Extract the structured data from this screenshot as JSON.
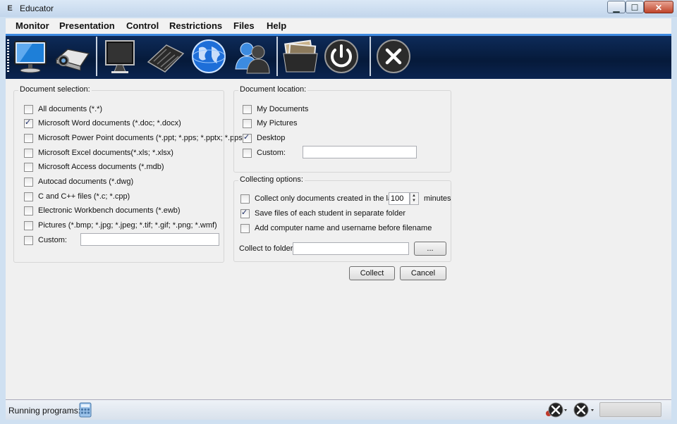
{
  "window": {
    "title": "Educator",
    "app_icon": "E"
  },
  "window_controls": {
    "minimize": "▁",
    "maximize": "☐",
    "close": "✕"
  },
  "menu": [
    "Monitor",
    "Presentation",
    "Control",
    "Restrictions",
    "Files",
    "Help"
  ],
  "toolbar_icons": [
    "monitor-icon",
    "projector-icon",
    "screen-icon",
    "keyboard-icon",
    "globe-icon",
    "users-icon",
    "photos-folder-icon",
    "power-icon",
    "close-circle-icon"
  ],
  "document_selection": {
    "title": "Document selection:",
    "items": [
      {
        "label": "All documents (*.*)",
        "checked": false
      },
      {
        "label": "Microsoft Word documents (*.doc; *.docx)",
        "checked": true
      },
      {
        "label": "Microsoft Power Point documents (*.ppt; *.pps; *.pptx; *.ppsx)",
        "checked": false
      },
      {
        "label": "Microsoft Excel documents(*.xls; *.xlsx)",
        "checked": false
      },
      {
        "label": "Microsoft Access documents (*.mdb)",
        "checked": false
      },
      {
        "label": "Autocad documents (*.dwg)",
        "checked": false
      },
      {
        "label": "C and C++ files (*.c; *.cpp)",
        "checked": false
      },
      {
        "label": "Electronic Workbench documents (*.ewb)",
        "checked": false
      },
      {
        "label": "Pictures (*.bmp; *.jpg; *.jpeg; *.tif; *.gif; *.png; *.wmf)",
        "checked": false
      },
      {
        "label": "Custom:",
        "checked": false
      }
    ],
    "custom_value": ""
  },
  "document_location": {
    "title": "Document location:",
    "items": [
      {
        "label": "My Documents",
        "checked": false
      },
      {
        "label": "My Pictures",
        "checked": false
      },
      {
        "label": "Desktop",
        "checked": true
      },
      {
        "label": "Custom:",
        "checked": false
      }
    ],
    "custom_value": ""
  },
  "collecting_options": {
    "title": "Collecting options:",
    "only_recent_label": "Collect only documents created in the last:",
    "only_recent_checked": false,
    "minutes_value": "100",
    "minutes_label": "minutes",
    "separate_folder_label": "Save files of each student in separate folder",
    "separate_folder_checked": true,
    "add_name_label": "Add computer name and username before filename",
    "add_name_checked": false,
    "folder_label": "Collect to folder:",
    "folder_value": "",
    "browse_label": "..."
  },
  "actions": {
    "collect": "Collect",
    "cancel": "Cancel"
  },
  "status": {
    "running_label": "Running programs:"
  }
}
